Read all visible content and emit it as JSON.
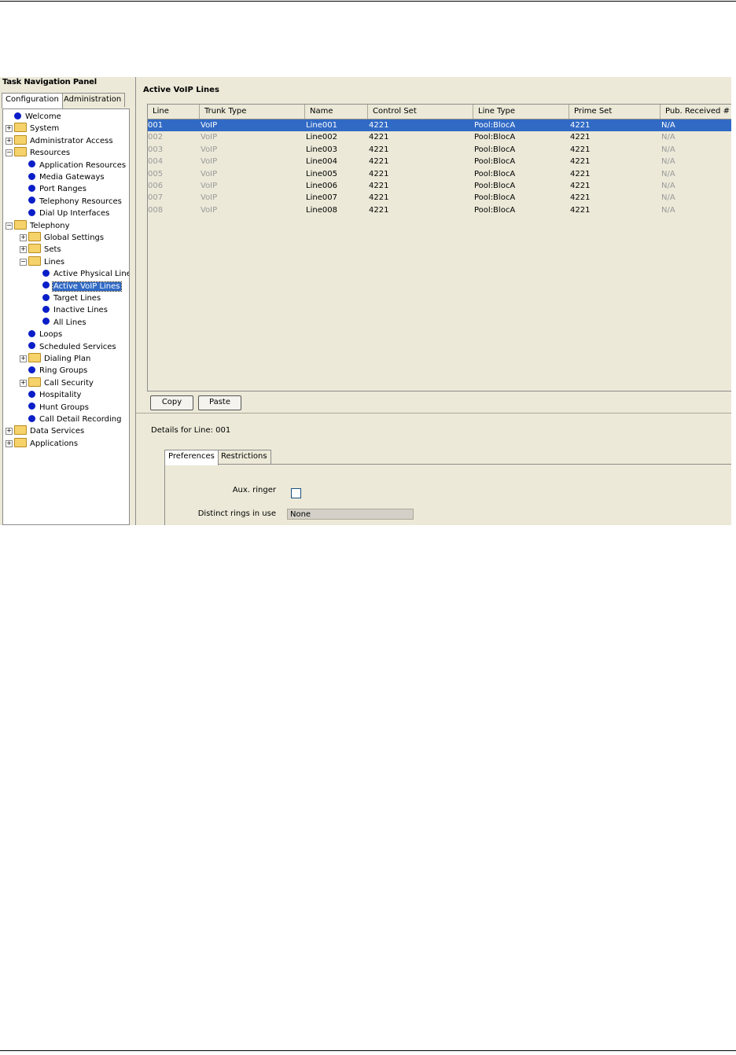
{
  "nav": {
    "title": "Task Navigation Panel",
    "tabs": [
      "Configuration",
      "Administration"
    ],
    "tree": [
      {
        "label": "Welcome",
        "kind": "leaf",
        "depth": 0
      },
      {
        "label": "System",
        "kind": "folder",
        "depth": 0
      },
      {
        "label": "Administrator Access",
        "kind": "folder",
        "depth": 0
      },
      {
        "label": "Resources",
        "kind": "folder",
        "depth": 0
      },
      {
        "label": "Application Resources",
        "kind": "leaf",
        "depth": 1
      },
      {
        "label": "Media Gateways",
        "kind": "leaf",
        "depth": 1
      },
      {
        "label": "Port Ranges",
        "kind": "leaf",
        "depth": 1
      },
      {
        "label": "Telephony Resources",
        "kind": "leaf",
        "depth": 1
      },
      {
        "label": "Dial Up Interfaces",
        "kind": "leaf",
        "depth": 1
      },
      {
        "label": "Telephony",
        "kind": "folder",
        "depth": 0
      },
      {
        "label": "Global Settings",
        "kind": "folder",
        "depth": 1
      },
      {
        "label": "Sets",
        "kind": "folder",
        "depth": 1
      },
      {
        "label": "Lines",
        "kind": "folder",
        "depth": 1
      },
      {
        "label": "Active Physical Lines",
        "kind": "leaf",
        "depth": 2
      },
      {
        "label": "Active VoIP Lines",
        "kind": "leaf",
        "depth": 2,
        "selected": true
      },
      {
        "label": "Target Lines",
        "kind": "leaf",
        "depth": 2
      },
      {
        "label": "Inactive Lines",
        "kind": "leaf",
        "depth": 2
      },
      {
        "label": "All Lines",
        "kind": "leaf",
        "depth": 2
      },
      {
        "label": "Loops",
        "kind": "leaf",
        "depth": 1
      },
      {
        "label": "Scheduled Services",
        "kind": "leaf",
        "depth": 1
      },
      {
        "label": "Dialing Plan",
        "kind": "folder",
        "depth": 1
      },
      {
        "label": "Ring Groups",
        "kind": "leaf",
        "depth": 1
      },
      {
        "label": "Call Security",
        "kind": "folder",
        "depth": 1
      },
      {
        "label": "Hospitality",
        "kind": "leaf",
        "depth": 1
      },
      {
        "label": "Hunt Groups",
        "kind": "leaf",
        "depth": 1
      },
      {
        "label": "Call Detail Recording",
        "kind": "leaf",
        "depth": 1
      },
      {
        "label": "Data Services",
        "kind": "folder",
        "depth": 0
      },
      {
        "label": "Applications",
        "kind": "folder",
        "depth": 0
      }
    ]
  },
  "main": {
    "title": "Active VoIP Lines",
    "columns": [
      "Line",
      "Trunk Type",
      "Name",
      "Control Set",
      "Line Type",
      "Prime Set",
      "Pub. Received #"
    ],
    "rows": [
      [
        "001",
        "VoIP",
        "Line001",
        "4221",
        "Pool:BlocA",
        "4221",
        "N/A"
      ],
      [
        "002",
        "VoIP",
        "Line002",
        "4221",
        "Pool:BlocA",
        "4221",
        "N/A"
      ],
      [
        "003",
        "VoIP",
        "Line003",
        "4221",
        "Pool:BlocA",
        "4221",
        "N/A"
      ],
      [
        "004",
        "VoIP",
        "Line004",
        "4221",
        "Pool:BlocA",
        "4221",
        "N/A"
      ],
      [
        "005",
        "VoIP",
        "Line005",
        "4221",
        "Pool:BlocA",
        "4221",
        "N/A"
      ],
      [
        "006",
        "VoIP",
        "Line006",
        "4221",
        "Pool:BlocA",
        "4221",
        "N/A"
      ],
      [
        "007",
        "VoIP",
        "Line007",
        "4221",
        "Pool:BlocA",
        "4221",
        "N/A"
      ],
      [
        "008",
        "VoIP",
        "Line008",
        "4221",
        "Pool:BlocA",
        "4221",
        "N/A"
      ]
    ],
    "copy_label": "Copy",
    "paste_label": "Paste",
    "details_label": "Details for Line: 001",
    "detail_tabs": [
      "Preferences",
      "Restrictions"
    ],
    "aux_ringer_label": "Aux. ringer",
    "aux_ringer_checked": false,
    "distinct_rings_label": "Distinct rings in use",
    "distinct_rings_value": "None"
  },
  "colors": {
    "selection": "#316ac5",
    "bullet": "#0a1ec8",
    "panel_bg": "#ece9d8",
    "folder": "#f6d26b"
  }
}
